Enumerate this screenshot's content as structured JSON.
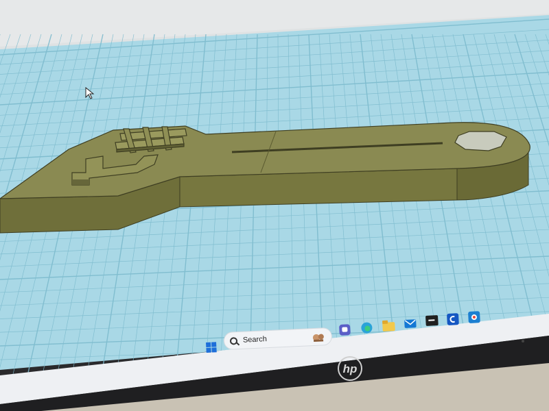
{
  "taskbar": {
    "search_label": "Search",
    "apps": [
      {
        "icon": "windows-start-icon",
        "color": "#1e6fd9"
      },
      {
        "icon": "teams-chat-icon",
        "color": "#5b5fc7"
      },
      {
        "icon": "edge-browser-icon",
        "color": "#2aa3d8"
      },
      {
        "icon": "file-explorer-icon",
        "color": "#f2c94c"
      },
      {
        "icon": "mail-icon",
        "color": "#1478d4"
      },
      {
        "icon": "terminal-icon",
        "color": "#202020"
      },
      {
        "icon": "app-c-icon",
        "color": "#1557c2"
      },
      {
        "icon": "app-e-icon",
        "color": "#1b7fd1"
      }
    ]
  },
  "laptop": {
    "brand_logo": "hp"
  },
  "model": {
    "color": "#8a8a52",
    "side_color": "#77773f",
    "edge_color": "#3e3e22"
  },
  "workplane": {
    "color": "#a9d8e6",
    "grid_color": "#7ab9cc"
  }
}
